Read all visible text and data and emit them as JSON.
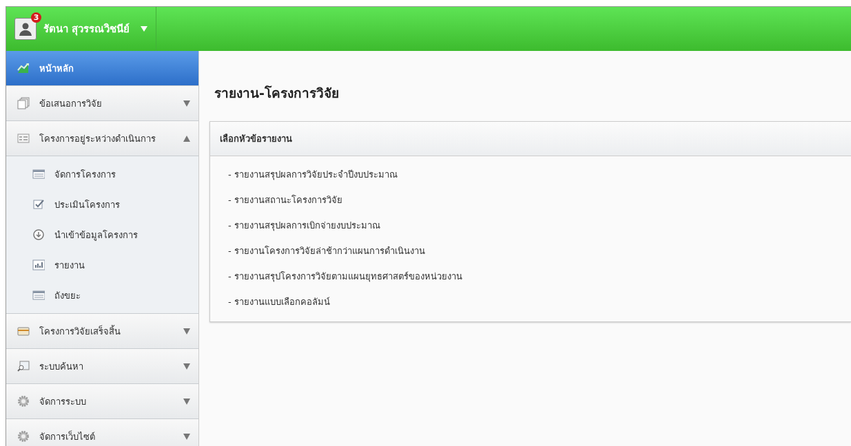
{
  "header": {
    "user_name": "รัตนา สุวรรณวิชนีย์",
    "notification_count": "3"
  },
  "sidebar": {
    "items": [
      {
        "label": "หน้าหลัก",
        "kind": "link",
        "selected": true
      },
      {
        "label": "ข้อเสนอการวิจัย",
        "kind": "section",
        "selected": false,
        "expanded": false
      },
      {
        "label": "โครงการอยู่ระหว่างดำเนินการ",
        "kind": "section",
        "selected": false,
        "expanded": true,
        "children": [
          {
            "label": "จัดการโครงการ"
          },
          {
            "label": "ประเมินโครงการ"
          },
          {
            "label": "นำเข้าข้อมูลโครงการ"
          },
          {
            "label": "รายงาน"
          },
          {
            "label": "ถังขยะ"
          }
        ]
      },
      {
        "label": "โครงการวิจัยเสร็จสิ้น",
        "kind": "section",
        "selected": false,
        "expanded": false
      },
      {
        "label": "ระบบค้นหา",
        "kind": "section",
        "selected": false,
        "expanded": false
      },
      {
        "label": "จัดการระบบ",
        "kind": "section",
        "selected": false,
        "expanded": false
      },
      {
        "label": "จัดการเว็บไซต์",
        "kind": "section",
        "selected": false,
        "expanded": false
      }
    ]
  },
  "main": {
    "title": "รายงาน-โครงการวิจัย",
    "panel": {
      "heading": "เลือกหัวข้อรายงาน",
      "links": [
        "- รายงานสรุปผลการวิจัยประจำปีงบประมาณ",
        "- รายงานสถานะโครงการวิจัย",
        "- รายงานสรุปผลการเบิกจ่ายงบประมาณ",
        "- รายงานโครงการวิจัยล่าช้ากว่าแผนการดำเนินงาน",
        "- รายงานสรุปโครงการวิจัยตามแผนยุทธศาสตร์ของหน่วยงาน",
        "- รายงานแบบเลือกคอลัมน์"
      ]
    }
  }
}
